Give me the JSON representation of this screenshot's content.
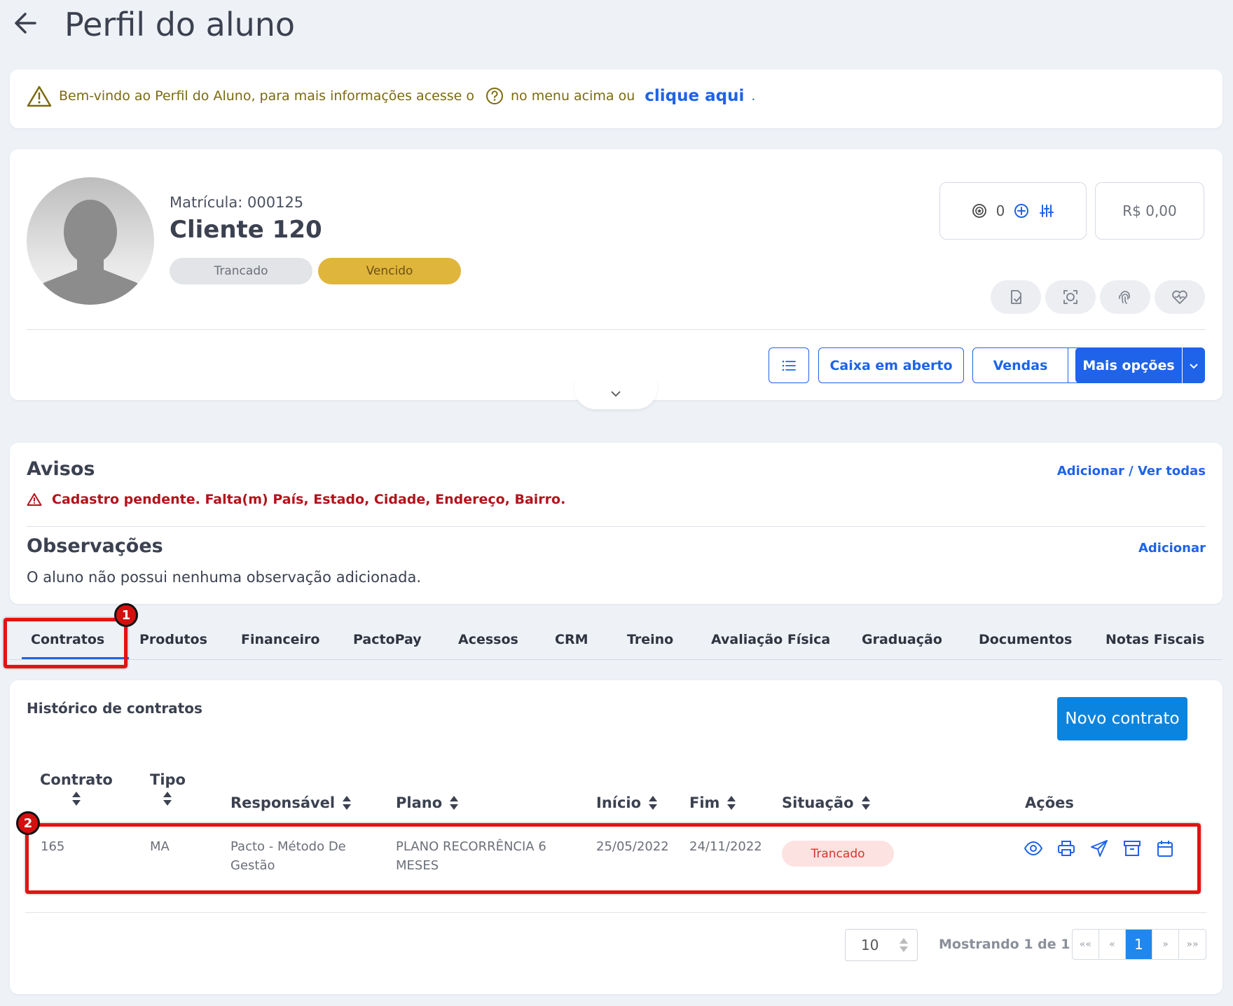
{
  "page": {
    "title": "Perfil do aluno"
  },
  "banner": {
    "text_before": "Bem-vindo ao Perfil do Aluno, para mais informações acesse o",
    "text_after": "no menu acima ou",
    "link": "clique aqui",
    "period": "."
  },
  "profile": {
    "matricula": "Matrícula: 000125",
    "name": "Cliente 120",
    "badges": [
      "Trancado",
      "Vencido"
    ],
    "points": "0",
    "balance": "R$ 0,00"
  },
  "actions": {
    "caixa": "Caixa em aberto",
    "vendas": "Vendas",
    "mais_opcoes": "Mais opções"
  },
  "avisos": {
    "title": "Avisos",
    "link": "Adicionar / Ver todas",
    "warning": "Cadastro pendente. Falta(m) País, Estado, Cidade, Endereço, Bairro."
  },
  "observacoes": {
    "title": "Observações",
    "link": "Adicionar",
    "empty": "O aluno não possui nenhuma observação adicionada."
  },
  "tabs": [
    "Contratos",
    "Produtos",
    "Financeiro",
    "PactoPay",
    "Acessos",
    "CRM",
    "Treino",
    "Avaliação Física",
    "Graduação",
    "Documentos",
    "Notas Fiscais"
  ],
  "annotations": [
    "1",
    "2"
  ],
  "contracts": {
    "title": "Histórico de contratos",
    "new_button": "Novo contrato",
    "columns": [
      "Contrato",
      "Tipo",
      "Responsável",
      "Plano",
      "Início",
      "Fim",
      "Situação",
      "Ações"
    ],
    "row": {
      "contrato": "165",
      "tipo": "MA",
      "responsavel_1": "Pacto - Método De",
      "responsavel_2": "Gestão",
      "plano_1": "PLANO RECORRÊNCIA 6",
      "plano_2": "MESES",
      "inicio": "25/05/2022",
      "fim": "24/11/2022",
      "situacao": "Trancado"
    },
    "per_page": "10",
    "showing": "Mostrando 1 de 1",
    "pager": [
      "««",
      "«",
      "1",
      "»",
      "»»"
    ]
  }
}
